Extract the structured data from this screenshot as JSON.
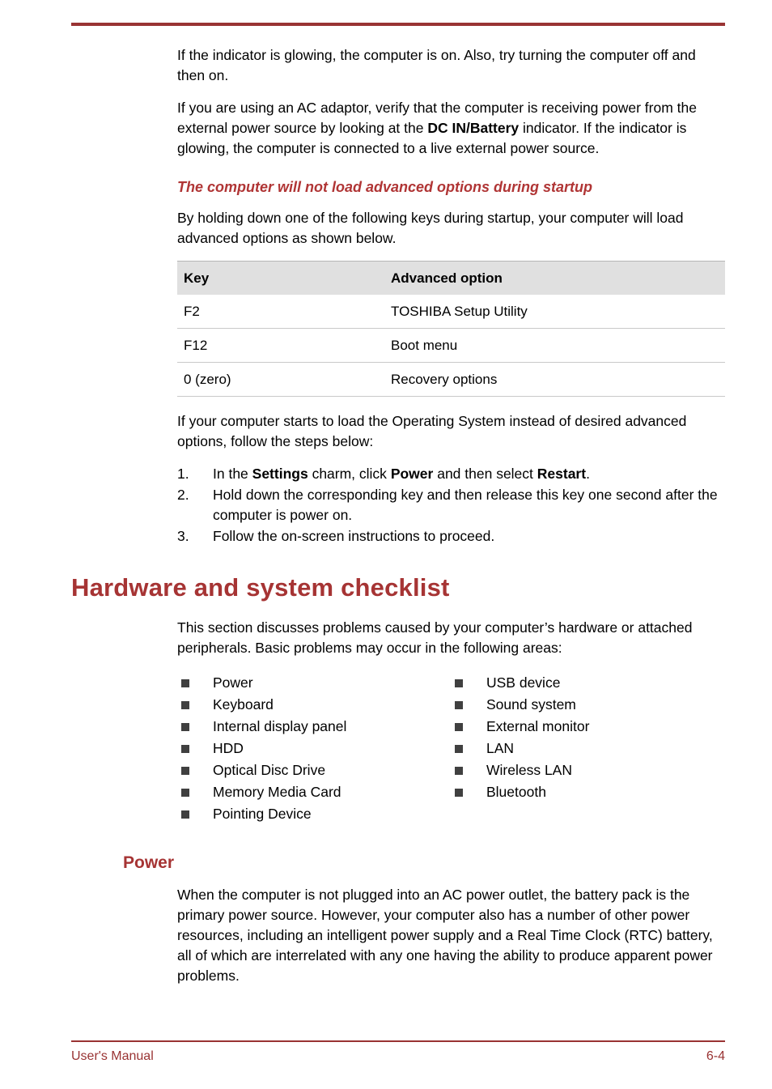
{
  "page": {
    "accent_color": "#993333",
    "heading_color": "#a63434",
    "table_header_bg": "#e0e0e0",
    "bullet_color": "#404040"
  },
  "body": {
    "para1": "If the indicator is glowing, the computer is on. Also, try turning the computer off and then on.",
    "para2_part1": "If you are using an AC adaptor, verify that the computer is receiving power from the external power source by looking at the ",
    "para2_bold": "DC IN/Battery",
    "para2_part2": " indicator. If the indicator is glowing, the computer is connected to a live external power source."
  },
  "subsection": {
    "heading": "The computer will not load advanced options during startup",
    "intro": "By holding down one of the following keys during startup, your computer will load advanced options as shown below."
  },
  "table": {
    "columns": [
      "Key",
      "Advanced option"
    ],
    "rows": [
      [
        "F2",
        "TOSHIBA Setup Utility"
      ],
      [
        "F12",
        "Boot menu"
      ],
      [
        "0 (zero)",
        "Recovery options"
      ]
    ]
  },
  "steps": {
    "intro": "If your computer starts to load the Operating System instead of desired advanced options, follow the steps below:",
    "items": [
      {
        "number": "1.",
        "part1": "In the ",
        "bold1": "Settings",
        "part2": " charm, click ",
        "bold2": "Power",
        "part3": " and then select ",
        "bold3": "Restart",
        "part4": "."
      },
      {
        "number": "2.",
        "part1": "Hold down the corresponding key and then release this key one second after the computer is power on.",
        "bold1": "",
        "part2": "",
        "bold2": "",
        "part3": "",
        "bold3": "",
        "part4": ""
      },
      {
        "number": "3.",
        "part1": "Follow the on-screen instructions to proceed.",
        "bold1": "",
        "part2": "",
        "bold2": "",
        "part3": "",
        "bold3": "",
        "part4": ""
      }
    ]
  },
  "section": {
    "heading": "Hardware and system checklist",
    "intro": "This section discusses problems caused by your computer’s hardware or attached peripherals. Basic problems may occur in the following areas:",
    "bullets_left": [
      "Power",
      "Keyboard",
      "Internal display panel",
      "HDD",
      "Optical Disc Drive",
      "Memory Media Card",
      "Pointing Device"
    ],
    "bullets_right": [
      "USB device",
      "Sound system",
      "External monitor",
      "LAN",
      "Wireless LAN",
      "Bluetooth"
    ]
  },
  "power": {
    "heading": "Power",
    "para": "When the computer is not plugged into an AC power outlet, the battery pack is the primary power source. However, your computer also has a number of other power resources, including an intelligent power supply and a Real Time Clock (RTC) battery, all of which are interrelated with any one having the ability to produce apparent power problems."
  },
  "footer": {
    "left": "User's Manual",
    "right": "6-4"
  }
}
